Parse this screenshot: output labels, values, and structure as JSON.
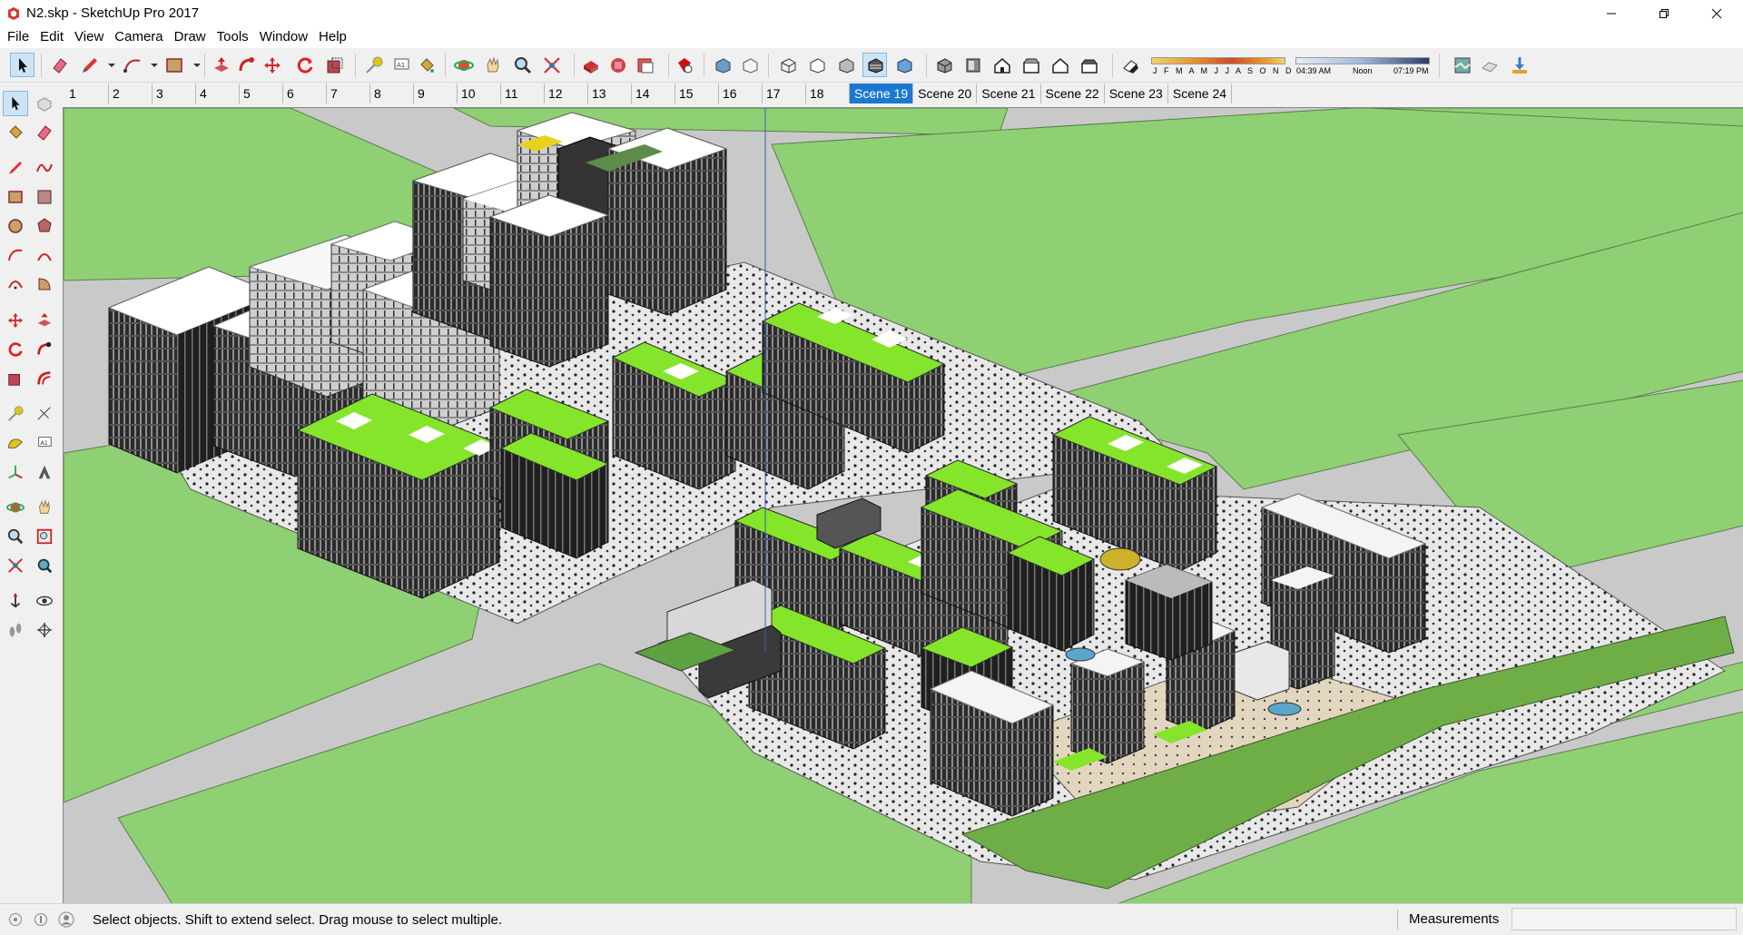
{
  "window": {
    "title": "N2.skp - SketchUp Pro 2017",
    "controls": [
      "minimize-icon",
      "restore-icon",
      "close-icon"
    ]
  },
  "menu": [
    "File",
    "Edit",
    "View",
    "Camera",
    "Draw",
    "Tools",
    "Window",
    "Help"
  ],
  "shadow_settings": {
    "months": "J F M A M J J A S O N D",
    "time_start": "04:39 AM",
    "time_mid": "Noon",
    "time_end": "07:19 PM"
  },
  "scenes": {
    "numbered": [
      "1",
      "2",
      "3",
      "4",
      "5",
      "6",
      "7",
      "8",
      "9",
      "10",
      "11",
      "12",
      "13",
      "14",
      "15",
      "16",
      "17",
      "18"
    ],
    "named": [
      "Scene 19",
      "Scene 20",
      "Scene 21",
      "Scene 22",
      "Scene 23",
      "Scene 24"
    ],
    "active": "Scene 19"
  },
  "toolbar_icons": [
    "select-icon",
    "eraser-icon",
    "pencil-icon",
    "arc-icon",
    "rectangle-icon",
    "push-pull-icon",
    "follow-me-icon",
    "move-icon",
    "rotate-icon",
    "scale-icon",
    "tape-measure-icon",
    "text-icon",
    "paint-bucket-icon",
    "orbit-icon",
    "pan-icon",
    "zoom-icon",
    "zoom-extents-icon",
    "warehouse-icon",
    "extension-warehouse-icon",
    "layout-icon",
    "extension-manager-icon",
    "xray-icon",
    "back-edges-icon",
    "wireframe-icon",
    "hidden-line-icon",
    "shaded-icon",
    "shaded-textures-icon",
    "monochrome-icon",
    "iso-view-icon",
    "top-view-icon",
    "front-view-icon",
    "right-view-icon",
    "back-view-icon",
    "left-view-icon",
    "shadows-icon",
    "map-icon",
    "location-icon",
    "photo-textures-icon"
  ],
  "status": {
    "hint": "Select objects. Shift to extend select. Drag mouse to select multiple.",
    "measurements_label": "Measurements",
    "measurements_value": ""
  },
  "colors": {
    "lawn": "#8fd074",
    "road": "#c9c9c9",
    "roof_green": "#84e52a",
    "facade_dark": "#2b2b2b",
    "active_scene": "#1b78d2"
  }
}
